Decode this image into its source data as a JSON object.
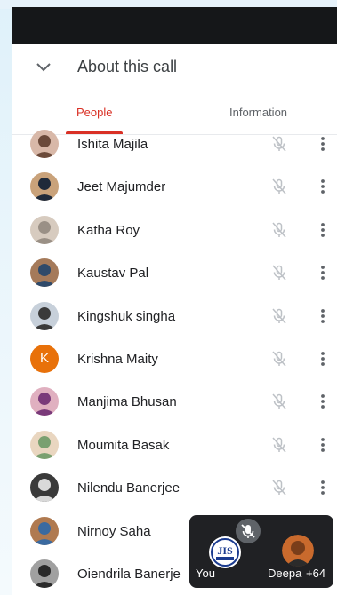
{
  "header": {
    "title": "About this call"
  },
  "tabs": [
    {
      "label": "People",
      "active": true
    },
    {
      "label": "Information",
      "active": false
    }
  ],
  "colors": {
    "accent": "#d93025",
    "text": "#202124",
    "muted": "#5f6368"
  },
  "participants": [
    {
      "name": "Ishita Majila",
      "avatar": "photo",
      "mic": "muted"
    },
    {
      "name": "Jeet Majumder",
      "avatar": "photo",
      "mic": "muted"
    },
    {
      "name": "Katha Roy",
      "avatar": "photo",
      "mic": "muted"
    },
    {
      "name": "Kaustav Pal",
      "avatar": "photo",
      "mic": "muted"
    },
    {
      "name": "Kingshuk singha",
      "avatar": "photo",
      "mic": "muted"
    },
    {
      "name": "Krishna Maity",
      "avatar": "letter",
      "initial": "K",
      "avatar_color": "#e8710a",
      "mic": "muted"
    },
    {
      "name": "Manjima Bhusan",
      "avatar": "photo",
      "mic": "muted"
    },
    {
      "name": "Moumita Basak",
      "avatar": "photo",
      "mic": "muted"
    },
    {
      "name": "Nilendu Banerjee",
      "avatar": "photo",
      "mic": "muted"
    },
    {
      "name": "Nirnoy Saha",
      "avatar": "photo",
      "mic": "muted"
    },
    {
      "name": "Oiendrila Banerje",
      "avatar": "photo",
      "mic": "muted"
    }
  ],
  "pip": {
    "you_label": "You",
    "other_label": "Deepa",
    "more_count": "+64"
  }
}
